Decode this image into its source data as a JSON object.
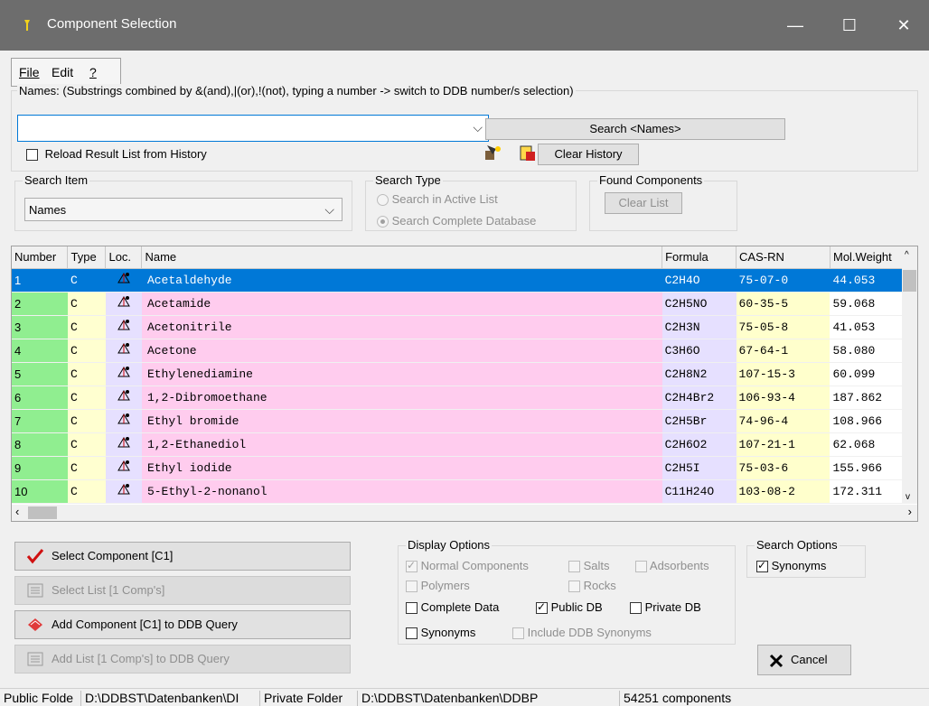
{
  "window": {
    "title": "Component Selection"
  },
  "menu": {
    "file": "File",
    "edit": "Edit",
    "help": "?"
  },
  "names": {
    "label": "Names: (Substrings combined by &(and),|(or),!(not), typing a number -> switch to DDB number/s selection)",
    "value": "",
    "search_button": "Search <Names>",
    "reload_label": "Reload Result List from History",
    "clear_history": "Clear History"
  },
  "search_item": {
    "label": "Search Item",
    "value": "Names"
  },
  "search_type": {
    "label": "Search Type",
    "active": "Search in  Active List",
    "complete": "Search Complete Database"
  },
  "found": {
    "label": "Found Components",
    "clear": "Clear List"
  },
  "grid": {
    "headers": [
      "Number",
      "Type",
      "Loc.",
      "Name",
      "Formula",
      "CAS-RN",
      "Mol.Weight"
    ],
    "rows": [
      [
        "1",
        "C",
        "Acetaldehyde",
        "C2H4O",
        "75-07-0",
        "44.053"
      ],
      [
        "2",
        "C",
        "Acetamide",
        "C2H5NO",
        "60-35-5",
        "59.068"
      ],
      [
        "3",
        "C",
        "Acetonitrile",
        "C2H3N",
        "75-05-8",
        "41.053"
      ],
      [
        "4",
        "C",
        "Acetone",
        "C3H6O",
        "67-64-1",
        "58.080"
      ],
      [
        "5",
        "C",
        "Ethylenediamine",
        "C2H8N2",
        "107-15-3",
        "60.099"
      ],
      [
        "6",
        "C",
        "1,2-Dibromoethane",
        "C2H4Br2",
        "106-93-4",
        "187.862"
      ],
      [
        "7",
        "C",
        "Ethyl bromide",
        "C2H5Br",
        "74-96-4",
        "108.966"
      ],
      [
        "8",
        "C",
        "1,2-Ethanediol",
        "C2H6O2",
        "107-21-1",
        "62.068"
      ],
      [
        "9",
        "C",
        "Ethyl iodide",
        "C2H5I",
        "75-03-6",
        "155.966"
      ],
      [
        "10",
        "C",
        "5-Ethyl-2-nonanol",
        "C11H24O",
        "103-08-2",
        "172.311"
      ]
    ]
  },
  "buttons": {
    "select_component": "Select Component [C1]",
    "select_list": "Select List [1 Comp's]",
    "add_component": "Add Component [C1] to DDB Query",
    "add_list": "Add List [1 Comp's] to DDB Query",
    "cancel": "Cancel"
  },
  "display_options": {
    "label": "Display Options",
    "normal": "Normal Components",
    "salts": "Salts",
    "adsorbents": "Adsorbents",
    "polymers": "Polymers",
    "rocks": "Rocks",
    "complete": "Complete Data",
    "public": "Public DB",
    "private": "Private DB",
    "synonyms": "Synonyms",
    "include_ddb": "Include DDB Synonyms"
  },
  "search_options": {
    "label": "Search Options",
    "synonyms": "Synonyms"
  },
  "status": {
    "public": "Public Folde",
    "public_path": "D:\\DDBST\\Datenbanken\\DI",
    "private": "Private Folder",
    "private_path": "D:\\DDBST\\Datenbanken\\DDBP",
    "count": "54251 components"
  }
}
